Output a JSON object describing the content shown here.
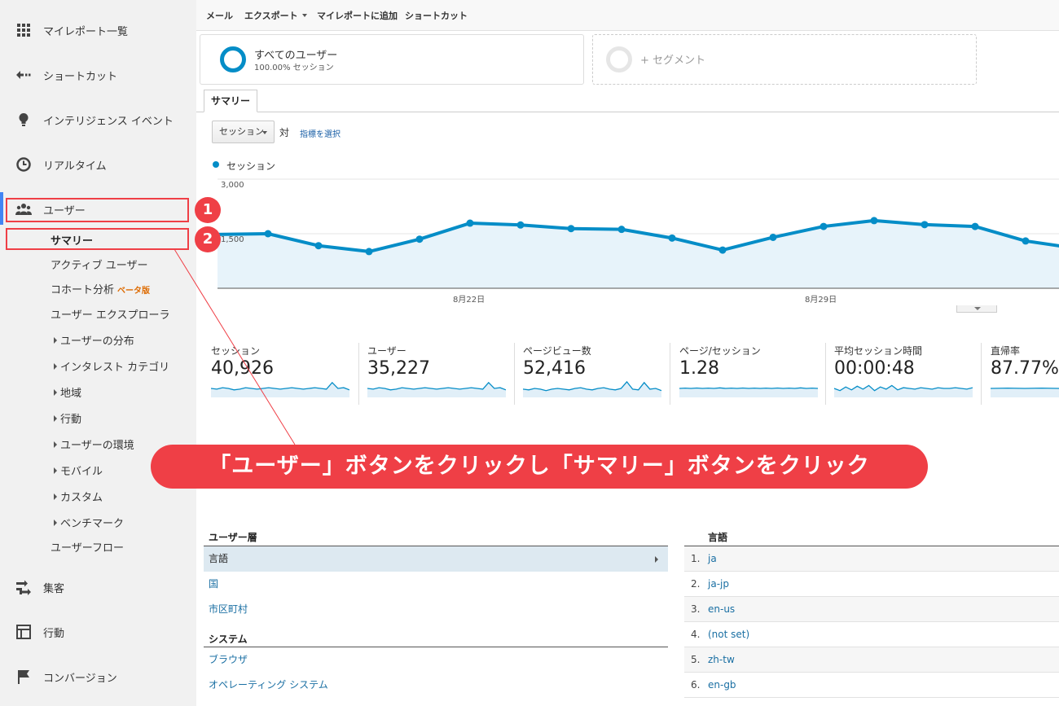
{
  "sidebar": {
    "top_items": [
      {
        "label": "マイレポート一覧",
        "icon": "grid-icon"
      },
      {
        "label": "ショートカット",
        "icon": "shortcut-arrow-icon"
      },
      {
        "label": "インテリジェンス イベント",
        "icon": "lightbulb-icon"
      },
      {
        "label": "リアルタイム",
        "icon": "clock-icon"
      },
      {
        "label": "ユーザー",
        "icon": "users-icon"
      }
    ],
    "sub_items": [
      {
        "label": "サマリー"
      },
      {
        "label": "アクティブ ユーザー"
      },
      {
        "label": "コホート分析",
        "badge": "ベータ版"
      },
      {
        "label": "ユーザー エクスプローラ"
      },
      {
        "label": "ユーザーの分布"
      },
      {
        "label": "インタレスト カテゴリ"
      },
      {
        "label": "地域"
      },
      {
        "label": "行動"
      },
      {
        "label": "ユーザーの環境"
      },
      {
        "label": "モバイル"
      },
      {
        "label": "カスタム"
      },
      {
        "label": "ベンチマーク"
      },
      {
        "label": "ユーザーフロー"
      }
    ],
    "bottom_items": [
      {
        "label": "集客",
        "icon": "acquisition-icon"
      },
      {
        "label": "行動",
        "icon": "behavior-icon"
      },
      {
        "label": "コンバージョン",
        "icon": "flag-icon"
      }
    ]
  },
  "toolbar": {
    "email": "メール",
    "export": "エクスポート",
    "add_to_report": "マイレポートに追加",
    "shortcut": "ショートカット"
  },
  "segments": {
    "all_users_title": "すべてのユーザー",
    "all_users_sub": "100.00% セッション",
    "add_segment": "+ セグメント"
  },
  "tabs": {
    "summary": "サマリー"
  },
  "chart_controls": {
    "metric": "セッション",
    "vs": "対",
    "choose_metric": "指標を選択"
  },
  "chart_data": {
    "type": "area",
    "series": [
      {
        "name": "セッション",
        "values": [
          1480,
          1500,
          1170,
          1010,
          1350,
          1790,
          1740,
          1640,
          1620,
          1380,
          1050,
          1400,
          1700,
          1860,
          1750,
          1700,
          1300,
          1100
        ]
      }
    ],
    "y_ticks": [
      "3,000",
      "1,500"
    ],
    "ylim": [
      0,
      3000
    ],
    "x_ticks": [
      "8月22日",
      "8月29日"
    ],
    "color": "#058dc7"
  },
  "metrics": [
    {
      "label": "セッション",
      "value": "40,926",
      "spark": [
        0.5,
        0.45,
        0.55,
        0.5,
        0.4,
        0.45,
        0.55,
        0.5,
        0.45,
        0.5,
        0.55,
        0.5,
        0.45,
        0.5,
        0.55,
        0.5,
        0.45,
        0.5,
        0.55,
        0.5,
        0.45,
        0.9,
        0.5,
        0.55,
        0.4
      ]
    },
    {
      "label": "ユーザー",
      "value": "35,227",
      "spark": [
        0.5,
        0.45,
        0.55,
        0.5,
        0.4,
        0.45,
        0.55,
        0.5,
        0.45,
        0.5,
        0.55,
        0.5,
        0.45,
        0.5,
        0.55,
        0.5,
        0.45,
        0.5,
        0.55,
        0.5,
        0.45,
        0.9,
        0.5,
        0.55,
        0.4
      ]
    },
    {
      "label": "ページビュー数",
      "value": "52,416",
      "spark": [
        0.45,
        0.4,
        0.5,
        0.45,
        0.35,
        0.45,
        0.5,
        0.45,
        0.4,
        0.5,
        0.55,
        0.45,
        0.4,
        0.5,
        0.55,
        0.45,
        0.4,
        0.5,
        0.95,
        0.45,
        0.4,
        0.9,
        0.45,
        0.5,
        0.35
      ]
    },
    {
      "label": "ページ/セッション",
      "value": "1.28",
      "spark": [
        0.5,
        0.52,
        0.5,
        0.53,
        0.5,
        0.52,
        0.5,
        0.54,
        0.5,
        0.52,
        0.5,
        0.53,
        0.5,
        0.52,
        0.5,
        0.52,
        0.5,
        0.53,
        0.5,
        0.52,
        0.5,
        0.54,
        0.5,
        0.52,
        0.5
      ]
    },
    {
      "label": "平均セッション時間",
      "value": "00:00:48",
      "spark": [
        0.5,
        0.35,
        0.6,
        0.4,
        0.65,
        0.45,
        0.7,
        0.35,
        0.6,
        0.45,
        0.7,
        0.4,
        0.55,
        0.5,
        0.45,
        0.55,
        0.5,
        0.45,
        0.55,
        0.5,
        0.5,
        0.55,
        0.5,
        0.45,
        0.55
      ]
    },
    {
      "label": "直帰率",
      "value": "87.77%",
      "spark": [
        0.5,
        0.52,
        0.5,
        0.52,
        0.5
      ]
    }
  ],
  "callout": "「ユーザー」ボタンをクリックし「サマリー」ボタンをクリック",
  "badges": [
    "1",
    "2"
  ],
  "demographics": {
    "header": "ユーザー層",
    "items": [
      "言語",
      "国",
      "市区町村"
    ],
    "system_header": "システム",
    "system_items": [
      "ブラウザ",
      "オペレーティング システム"
    ]
  },
  "language_table": {
    "header": "言語",
    "rows": [
      {
        "num": "1.",
        "value": "ja"
      },
      {
        "num": "2.",
        "value": "ja-jp"
      },
      {
        "num": "3.",
        "value": "en-us"
      },
      {
        "num": "4.",
        "value": "(not set)"
      },
      {
        "num": "5.",
        "value": "zh-tw"
      },
      {
        "num": "6.",
        "value": "en-gb"
      }
    ]
  },
  "colors": {
    "accent": "#058dc7",
    "annotation": "#ef3f46",
    "link": "#1a6fa3"
  }
}
